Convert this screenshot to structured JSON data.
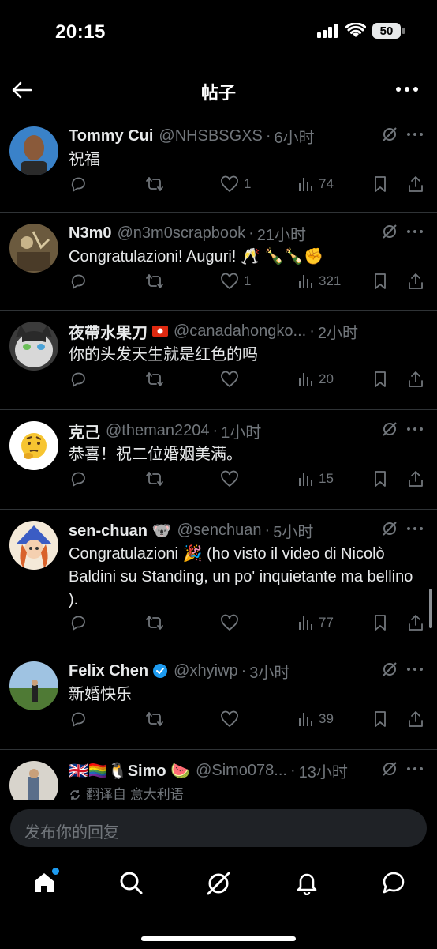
{
  "status_bar": {
    "time": "20:15",
    "battery": "50"
  },
  "header": {
    "title": "帖子"
  },
  "posts": [
    {
      "name": "Tommy Cui",
      "handle": "@NHSBSGXS",
      "time": "6小时",
      "text": "祝福",
      "likes": "1",
      "views": "74"
    },
    {
      "name": "N3m0",
      "handle": "@n3m0scrapbook",
      "time": "21小时",
      "text": "Congratulazioni! Auguri! 🥂 🍾🍾✊",
      "likes": "1",
      "views": "321"
    },
    {
      "name": "夜帶水果刀",
      "handle": "@canadahongko...",
      "time": "2小时",
      "text": "你的头发天生就是红色的吗",
      "likes": "",
      "views": "20"
    },
    {
      "name": "克己",
      "handle": "@theman2204",
      "time": "1小时",
      "text": "恭喜！祝二位婚姻美满。",
      "likes": "",
      "views": "15"
    },
    {
      "name": "sen-chuan 🐨",
      "handle": "@senchuan",
      "time": "5小时",
      "text": "Congratulazioni 🎉 (ho visto il video di Nicolò Baldini su Standing, un po' inquietante ma bellino ).",
      "likes": "",
      "views": "77"
    },
    {
      "name": "Felix Chen",
      "handle": "@xhyiwp",
      "time": "3小时",
      "text": "新婚快乐",
      "likes": "",
      "views": "39"
    },
    {
      "name": "🇬🇧🏳️‍🌈🐧Simo 🍉",
      "handle": "@Simo078...",
      "time": "13小时",
      "text": "翻译自 意大利语"
    }
  ],
  "reply_box": {
    "placeholder": "发布你的回复"
  },
  "icons": [
    "back-arrow-icon",
    "more-icon",
    "grok-icon",
    "reply-icon",
    "repost-icon",
    "like-icon",
    "views-icon",
    "bookmark-icon",
    "share-icon",
    "home-icon",
    "search-icon",
    "notifications-icon",
    "messages-icon"
  ],
  "colors": {
    "background": "#000000",
    "text": "#e7e9ea",
    "secondary": "#71767b",
    "accent": "#1d9bf0"
  }
}
